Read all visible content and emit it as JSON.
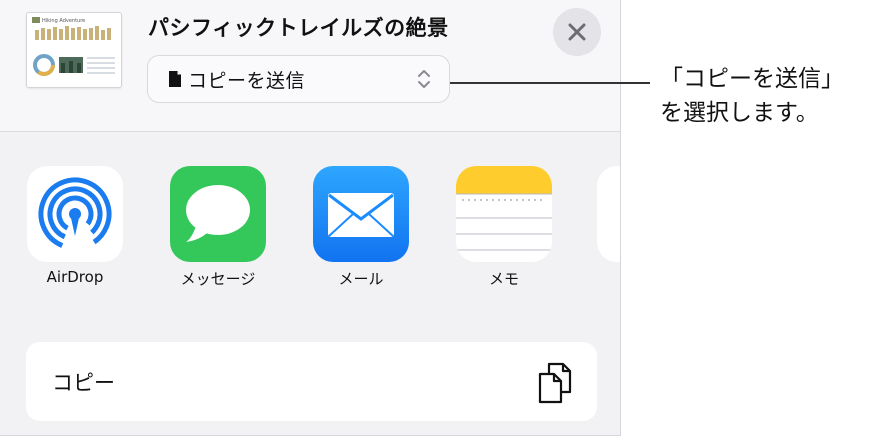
{
  "sheet": {
    "title": "パシフィックトレイルズの絶景",
    "send_option": "コピーを送信",
    "close_label": "close",
    "thumbnail_heading": "Hiking Adventure"
  },
  "callout": {
    "text": "「コピーを送信」\nを選択します。"
  },
  "apps": [
    {
      "label": "AirDrop",
      "icon": "airdrop-icon"
    },
    {
      "label": "メッセージ",
      "icon": "messages-icon"
    },
    {
      "label": "メール",
      "icon": "mail-icon"
    },
    {
      "label": "メモ",
      "icon": "notes-icon"
    }
  ],
  "actions": {
    "copy_label": "コピー",
    "copy_icon": "copy-icon"
  },
  "colors": {
    "messages_green": "#34c759",
    "mail_blue": "#1a8cff",
    "airdrop_blue": "#1b7cf0",
    "notes_yellow": "#ffcc2e"
  }
}
